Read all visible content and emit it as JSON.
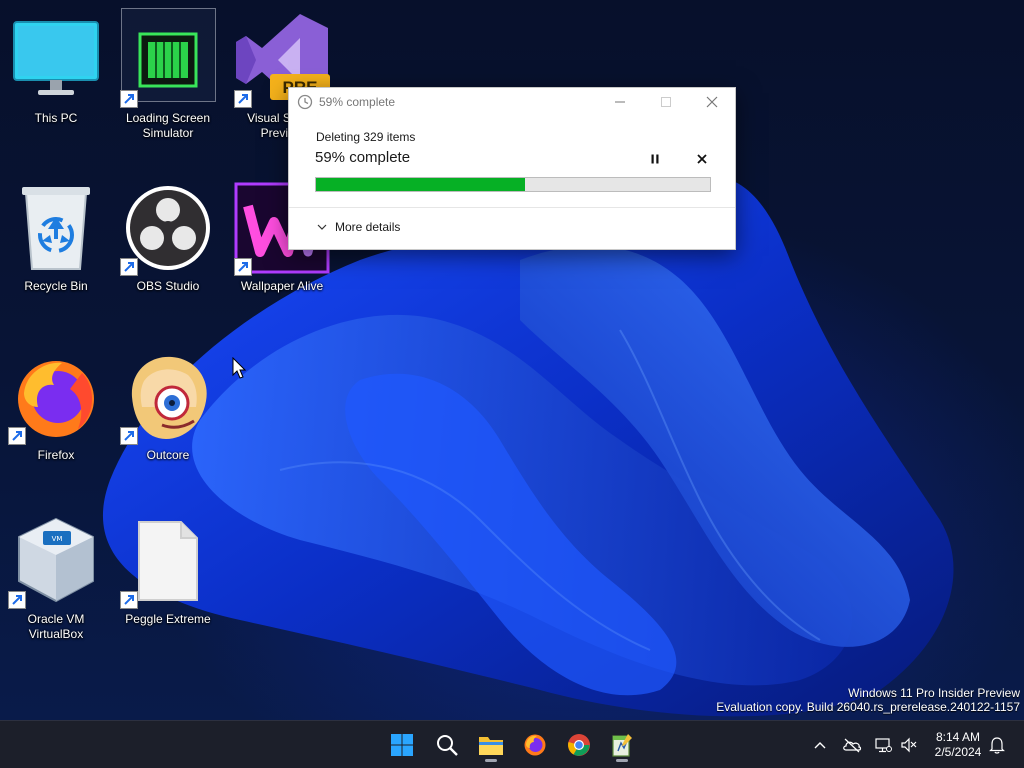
{
  "desktop": {
    "icons": [
      {
        "label": "This PC"
      },
      {
        "label": "Loading Screen Simulator"
      },
      {
        "label": "Visual Studio Preview"
      },
      {
        "label": "Recycle Bin"
      },
      {
        "label": "OBS Studio"
      },
      {
        "label": "Wallpaper Alive"
      },
      {
        "label": "Firefox"
      },
      {
        "label": "Outcore"
      },
      {
        "label": "Oracle VM VirtualBox"
      },
      {
        "label": "Peggle Extreme"
      }
    ],
    "vs_badge": "PRE"
  },
  "dialog": {
    "title": "59% complete",
    "operation": "Deleting 329 items",
    "percent_text": "59% complete",
    "progress_fraction": 0.53,
    "more_details_label": "More details"
  },
  "watermark": {
    "line1": "Windows 11 Pro Insider Preview",
    "line2": "Evaluation copy. Build 26040.rs_prerelease.240122-1157"
  },
  "taskbar": {
    "apps": [
      "start-icon",
      "search-icon",
      "file-explorer-icon",
      "firefox-icon",
      "chrome-icon",
      "notepad-icon"
    ],
    "tray": [
      "chevron-up-icon",
      "onedrive-offline-icon",
      "network-icon",
      "volume-muted-icon",
      "bell-icon"
    ],
    "time": "8:14 AM",
    "date": "2/5/2024"
  },
  "colors": {
    "progress_green": "#06b025",
    "taskbar_bg": "#1c1f2a",
    "accent_blue": "#0a5cff"
  }
}
